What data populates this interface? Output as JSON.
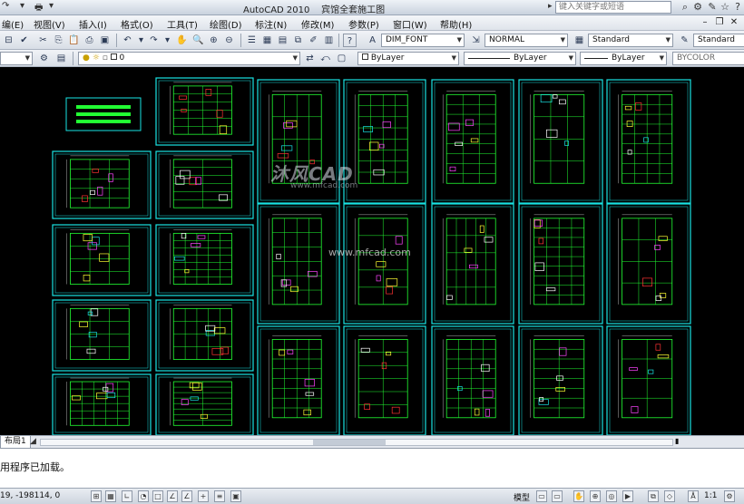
{
  "titlebar": {
    "title": "AutoCAD 2010",
    "document": "宾馆全套施工图",
    "search_placeholder": "键入关键字或短语"
  },
  "menubar": {
    "items": [
      "编(E)",
      "视图(V)",
      "插入(I)",
      "格式(O)",
      "工具(T)",
      "绘图(D)",
      "标注(N)",
      "修改(M)",
      "参数(P)",
      "窗口(W)",
      "帮助(H)"
    ]
  },
  "toolbar1": {
    "dimstyle_value": "DIM_FONT",
    "textstyle_value": "NORMAL",
    "tablestyle_value": "Standard",
    "multileader_value": "Standard"
  },
  "toolbar2": {
    "layer_value": "0",
    "color_value": "ByLayer",
    "linetype_value": "ByLayer",
    "lineweight_value": "ByLayer",
    "plotstyle_value": "BYCOLOR"
  },
  "watermark": {
    "brand": "沐风CAD",
    "url_small": "www.mfcad.com",
    "url": "www.mfcad.com"
  },
  "tabs": {
    "layout_label": "布局1"
  },
  "command": {
    "message": "用程序已加载。"
  },
  "statusbar": {
    "coordinates": "19,  -198114,  0",
    "model_label": "模型",
    "scale_label": "1:1"
  },
  "colors": {
    "sheet_border": "#19e3e3",
    "drawing_bg": "#000000",
    "plan_line": "#22ff33",
    "accent_yellow": "#ffff33",
    "accent_magenta": "#ff44ff"
  }
}
